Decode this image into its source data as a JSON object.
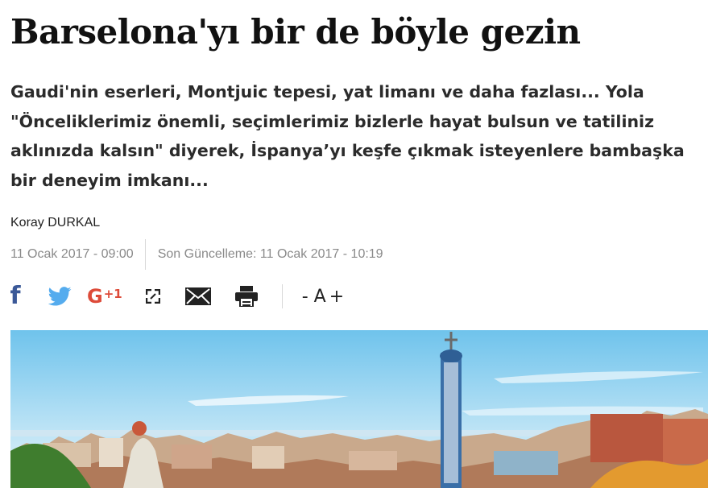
{
  "article": {
    "title": "Barselona'yı bir de böyle gezin",
    "summary": "Gaudi'nin eserleri, Montjuic tepesi, yat limanı ve daha fazlası... Yola \"Önceliklerimiz önemli, seçimlerimiz bizlerle hayat bulsun ve tatiliniz aklınızda kalsın\" diyerek, İspanya’yı keşfe çıkmak isteyenlere bambaşka bir deneyim imkanı...",
    "author": "Koray DURKAL",
    "published": "11 Ocak 2017 - 09:00",
    "updated": "Son Güncelleme: 11 Ocak 2017 - 10:19"
  },
  "share": {
    "facebook_glyph": "f",
    "gplus_g": "G",
    "gplus_plus": "+1",
    "icons": [
      "facebook-icon",
      "twitter-icon",
      "google-plus-icon",
      "expand-icon",
      "email-icon",
      "print-icon"
    ],
    "colors": {
      "facebook": "#3b5998",
      "twitter": "#55acee",
      "gplus": "#dd4b39"
    }
  },
  "font_controls": {
    "decrease": "- A",
    "increase": "+"
  }
}
